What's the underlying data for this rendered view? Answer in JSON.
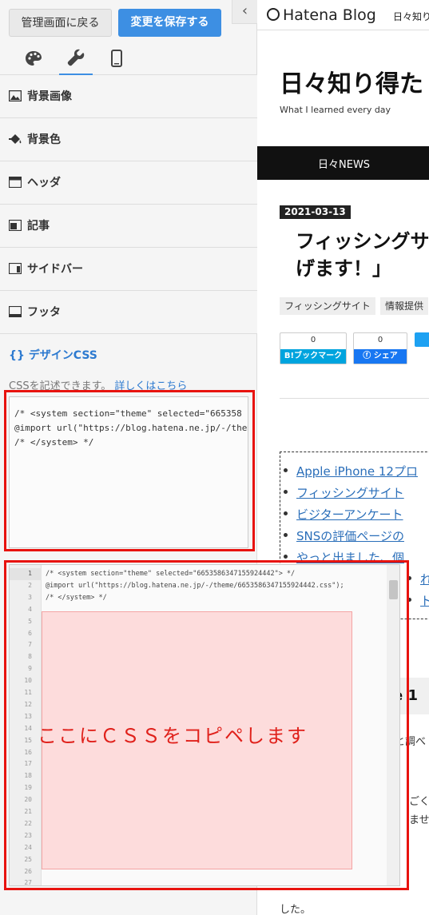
{
  "toolbar": {
    "back_label": "管理画面に戻る",
    "save_label": "変更を保存する",
    "collapse_glyph": "‹"
  },
  "tabs": [
    {
      "name": "palette-icon",
      "active": false
    },
    {
      "name": "wrench-icon",
      "active": true
    },
    {
      "name": "smartphone-icon",
      "active": false
    }
  ],
  "menu": {
    "items": [
      {
        "label": "背景画像",
        "icon": "image-icon"
      },
      {
        "label": "背景色",
        "icon": "paint-bucket-icon"
      },
      {
        "label": "ヘッダ",
        "icon": "layout-header-icon"
      },
      {
        "label": "記事",
        "icon": "layout-article-icon"
      },
      {
        "label": "サイドバー",
        "icon": "layout-sidebar-icon"
      },
      {
        "label": "フッタ",
        "icon": "layout-footer-icon"
      }
    ]
  },
  "design_css": {
    "title": "{} デザインCSS",
    "description": "CSSを記述できます。",
    "link": "詳しくはこちら",
    "textarea_lines": [
      "/* <system section=\"theme\" selected=\"665358",
      "@import url(\"https://blog.hatena.ne.jp/-/theme",
      "/* </system> */"
    ]
  },
  "editor": {
    "lines": [
      "/* <system section=\"theme\" selected=\"6653586347155924442\"> */",
      "@import url(\"https://blog.hatena.ne.jp/-/theme/6653586347155924442.css\");",
      "/* </system> */"
    ],
    "line_numbers": [
      "1",
      "2",
      "3",
      "4",
      "5",
      "6",
      "7",
      "8",
      "9",
      "10",
      "11",
      "12",
      "13",
      "14",
      "15",
      "16",
      "17",
      "18",
      "19",
      "20",
      "21",
      "22",
      "23",
      "24",
      "25",
      "26",
      "27"
    ],
    "annotation": "ここにＣＳＳをコピペします"
  },
  "preview": {
    "logo_text": "Hatena Blog",
    "header_blog_name": "日々知り",
    "blog_title": "日々知り得た",
    "blog_description": "What I learned every day",
    "nav_item": "日々NEWS",
    "date": "2021-03-13",
    "post_title_line1": "フィッシングサ",
    "post_title_line2": "げます！」",
    "categories": [
      "フィッシングサイト",
      "情報提供"
    ],
    "bookmark_count": "0",
    "bookmark_label": "B!ブックマーク",
    "facebook_count": "0",
    "facebook_label": "シェア",
    "toc_items": [
      "Apple iPhone 12プロ",
      "フィッシングサイト",
      "ビジターアンケート",
      "SNSの評価ページの",
      "やっと出ました、個"
    ],
    "toc_overflow_1": "れる",
    "toc_overflow_2": "ト",
    "h2_fragment": "e 1",
    "body_fragments": [
      "と調べ",
      "ごく",
      "ません",
      "した。"
    ]
  },
  "colors": {
    "accent": "#3d8fe3",
    "annotation_red": "#e8130f",
    "paste_zone": "#ffbebe"
  }
}
